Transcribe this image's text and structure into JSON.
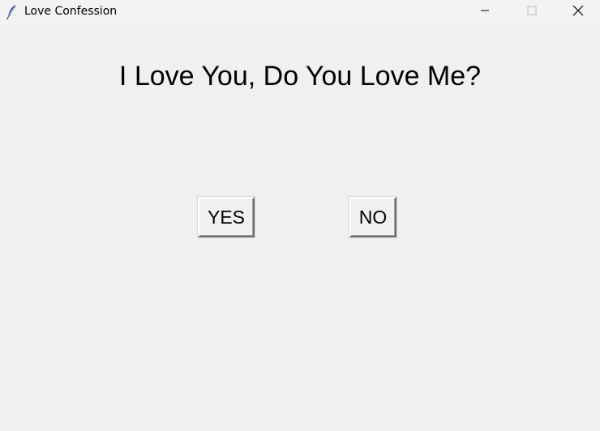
{
  "window": {
    "title": "Love Confession",
    "icon": "feather-icon",
    "controls": {
      "minimize_icon": "minimize-icon",
      "maximize_icon": "maximize-icon",
      "close_icon": "close-icon"
    }
  },
  "main": {
    "question": "I Love You, Do You Love Me?",
    "yes_label": "YES",
    "no_label": "NO"
  },
  "colors": {
    "background": "#f0f0f0",
    "titlebar": "#f3f3f3",
    "text": "#000000"
  }
}
